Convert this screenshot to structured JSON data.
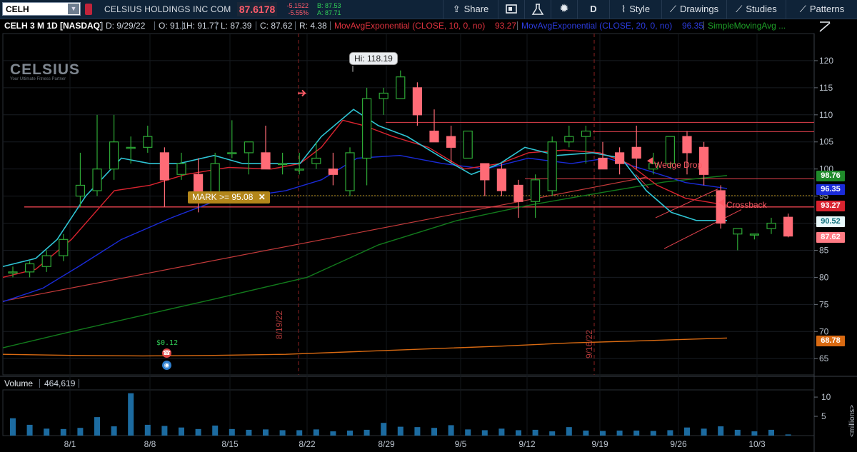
{
  "toolbar": {
    "symbol": "CELH",
    "dropdown_glyph": "▼",
    "company": "CELSIUS HOLDINGS INC COM",
    "last": "87.6178",
    "net_change": "-5.1522",
    "pct_change": "-5.55%",
    "bid": "B: 87.53",
    "ask": "A: 87.71",
    "buttons": {
      "share": "Share",
      "timeframe": "D",
      "style": "Style",
      "drawings": "Drawings",
      "studies": "Studies",
      "patterns": "Patterns"
    },
    "icons": [
      "share-icon",
      "snapshot-icon",
      "flask-icon",
      "gear-icon",
      "style-icon",
      "drawings-icon",
      "studies-icon",
      "patterns-icon"
    ]
  },
  "header": {
    "title": "CELH 3 M 1D [NASDAQ]",
    "date": "D: 9/29/22",
    "open": "O: 91.1",
    "high": "H: 91.77",
    "low": "L: 87.39",
    "close": "C: 87.62",
    "range": "R: 4.38",
    "ema10_label": "MovAvgExponential (CLOSE, 10, 0, no)",
    "ema10_value": "93.27",
    "ema20_label": "MovAvgExponential (CLOSE, 20, 0, no)",
    "ema20_value": "96.35",
    "sma_label": "SimpleMovingAvg ..."
  },
  "logo": {
    "name": "CELSIUS",
    "tagline": "Your Ultimate Fitness Partner"
  },
  "annotations": {
    "hi_label": "Hi: 118.19",
    "mark_label": "MARK >= 95.08",
    "mark_close": "✕",
    "wedge_drop": "Wedge Drop",
    "crossback": "Crossback",
    "date_mark_1": "8/19/22",
    "date_mark_2": "9/16/22",
    "dividend": "$0.12"
  },
  "volume": {
    "label": "Volume",
    "value": "464,619",
    "unit": "<millions>"
  },
  "colors": {
    "up": "#2ea836",
    "down": "#ff6b76",
    "ema10": "#d9232f",
    "ema9_cyan": "#2fc4d4",
    "ema20": "#1a2bd8",
    "sma_green": "#127a1c",
    "sma_orange": "#d96a12",
    "volume": "#1c6ba0",
    "hline": "#e6434e",
    "mark_line": "#b8921a"
  },
  "chart_data": {
    "type": "candlestick",
    "ylim": [
      62,
      125
    ],
    "y_ticks": [
      65,
      70,
      75,
      80,
      85,
      90,
      95,
      100,
      105,
      110,
      115,
      120
    ],
    "x_ticks": [
      "8/1",
      "8/8",
      "8/15",
      "8/22",
      "8/29",
      "9/5",
      "9/12",
      "9/19",
      "9/26",
      "10/3"
    ],
    "price_tags": [
      {
        "value": "98.76",
        "series": "SMA"
      },
      {
        "value": "96.35",
        "series": "EMA20"
      },
      {
        "value": "93.27",
        "series": "EMA10"
      },
      {
        "value": "90.52",
        "series": "EMA (cyan)"
      },
      {
        "value": "87.62",
        "series": "Last"
      },
      {
        "value": "68.78",
        "series": "SMA (orange)"
      }
    ],
    "hlines": [
      93.0,
      95.08,
      98.2,
      106.9,
      108.6
    ],
    "ohlc": [
      [
        "7/26",
        81,
        82,
        80,
        81
      ],
      [
        "7/27",
        81,
        83,
        80,
        82.5
      ],
      [
        "7/28",
        82,
        85,
        81,
        84
      ],
      [
        "7/29",
        84,
        88,
        83,
        87
      ],
      [
        "8/1",
        95,
        103,
        93,
        97
      ],
      [
        "8/2",
        96,
        110,
        95,
        100
      ],
      [
        "8/3",
        100,
        110,
        98,
        105
      ],
      [
        "8/4",
        104,
        106,
        101,
        104
      ],
      [
        "8/5",
        104,
        108,
        103,
        106
      ],
      [
        "8/8",
        103,
        104,
        93,
        98
      ],
      [
        "8/9",
        99,
        103,
        98,
        101
      ],
      [
        "8/10",
        99,
        102,
        92,
        95
      ],
      [
        "8/11",
        95,
        103,
        94,
        101
      ],
      [
        "8/12",
        103,
        109,
        102,
        103
      ],
      [
        "8/15",
        103,
        105,
        99,
        105
      ],
      [
        "8/16",
        103,
        108,
        100,
        100
      ],
      [
        "8/17",
        101,
        103,
        99,
        101
      ],
      [
        "8/18",
        100,
        103,
        99,
        100
      ],
      [
        "8/19",
        101,
        105,
        100,
        102
      ],
      [
        "8/22",
        100,
        103,
        97,
        99
      ],
      [
        "8/23",
        96,
        104,
        95,
        103
      ],
      [
        "8/24",
        102,
        115,
        97,
        113
      ],
      [
        "8/25",
        113,
        115,
        110,
        114
      ],
      [
        "8/26",
        113,
        118.19,
        113,
        117
      ],
      [
        "8/29",
        115,
        116,
        108,
        110
      ],
      [
        "8/30",
        107,
        111,
        106,
        105
      ],
      [
        "8/31",
        106,
        108,
        101,
        104
      ],
      [
        "9/1",
        102,
        107,
        102,
        107
      ],
      [
        "9/2",
        101,
        101,
        95,
        98
      ],
      [
        "9/6",
        100,
        101,
        95,
        96
      ],
      [
        "9/7",
        97,
        98,
        91,
        94
      ],
      [
        "9/8",
        94,
        99,
        91,
        98
      ],
      [
        "9/9",
        96,
        106,
        95,
        105
      ],
      [
        "9/12",
        105,
        108,
        104,
        106
      ],
      [
        "9/13",
        106,
        108,
        101,
        107
      ],
      [
        "9/14",
        102,
        105,
        100,
        100
      ],
      [
        "9/15",
        103,
        104,
        99,
        101
      ],
      [
        "9/16",
        104,
        108,
        100,
        102
      ],
      [
        "9/19",
        100,
        103,
        99,
        101
      ],
      [
        "9/20",
        101,
        106,
        100,
        106
      ],
      [
        "9/21",
        106,
        107,
        99,
        103
      ],
      [
        "9/22",
        104,
        105,
        97,
        99
      ],
      [
        "9/23",
        96,
        97,
        89,
        90
      ],
      [
        "9/26",
        88,
        89,
        85,
        89
      ],
      [
        "9/27",
        88,
        88,
        87,
        88
      ],
      [
        "9/28",
        89,
        91,
        88,
        90
      ],
      [
        "9/29",
        91.1,
        91.77,
        87.39,
        87.62
      ]
    ],
    "volume_millions": [
      4.5,
      2.8,
      1.8,
      1.7,
      2,
      4.8,
      2.4,
      11,
      2.8,
      2.5,
      2.1,
      1.7,
      2.6,
      1.7,
      1.5,
      1.6,
      1.4,
      1.4,
      1.6,
      1.1,
      1.3,
      1.5,
      3.3,
      2.3,
      2.2,
      2,
      2.7,
      1.6,
      1.4,
      1.8,
      1.4,
      1.5,
      1.1,
      2.2,
      1.3,
      1.2,
      1.3,
      1.3,
      1.2,
      1.4,
      2.1,
      1.8,
      2.4,
      1.5,
      1.1,
      1.5,
      0.3
    ],
    "volume_ticks": [
      5,
      10
    ]
  }
}
